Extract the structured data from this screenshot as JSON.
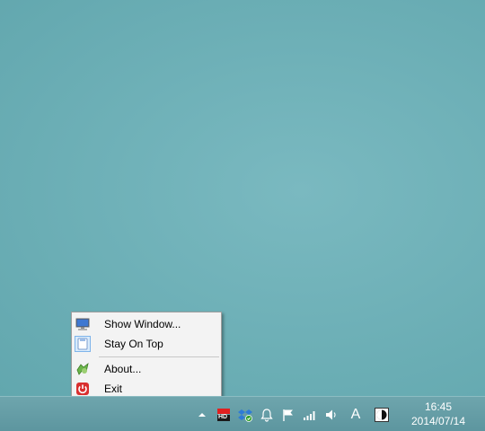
{
  "context_menu": {
    "items": [
      {
        "label": "Show Window...",
        "icon": "monitor-icon"
      },
      {
        "label": "Stay On Top",
        "icon": "pin-window-icon"
      },
      {
        "label": "About...",
        "icon": "about-icon"
      },
      {
        "label": "Exit",
        "icon": "power-icon"
      }
    ]
  },
  "taskbar": {
    "tray_icons": [
      "show-hidden-icons-arrow",
      "hd-indicator-icon",
      "dropbox-icon",
      "notification-bell-icon",
      "action-center-flag-icon",
      "network-signal-icon",
      "volume-icon",
      "ime-mode-icon",
      "app-tray-icon"
    ],
    "ime_label": "A",
    "hd_label": "HD",
    "clock_time": "16:45",
    "clock_date": "2014/07/14"
  },
  "colors": {
    "desktop": "#6fb1b8",
    "taskbar": "#6ea5ad",
    "menu_bg": "#f3f3f3"
  }
}
